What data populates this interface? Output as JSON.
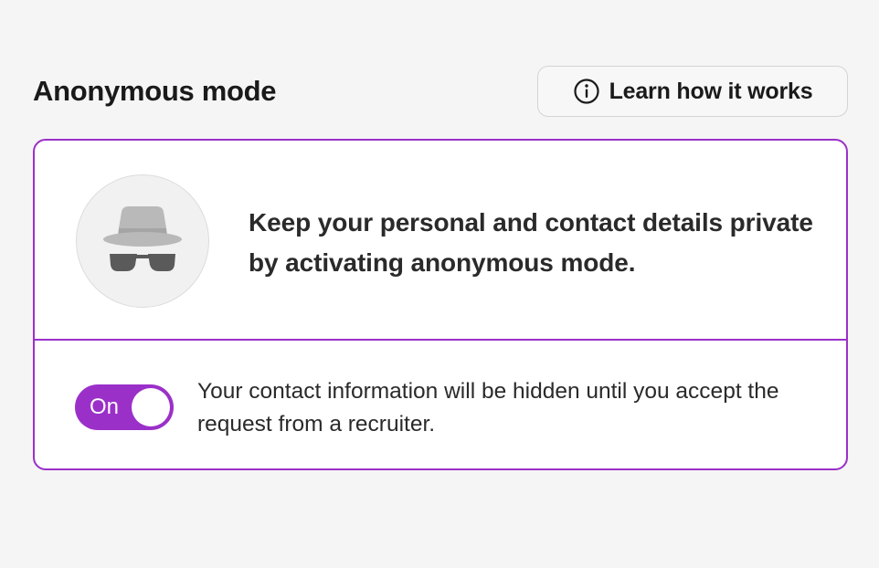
{
  "header": {
    "title": "Anonymous mode",
    "learn_button_label": "Learn how it works",
    "learn_button_icon": "info-icon"
  },
  "card": {
    "border_color": "#9b30c9",
    "avatar_icon": "incognito-icon",
    "intro_text": "Keep your personal and contact details private by activating anonymous mode.",
    "toggle": {
      "label": "On",
      "state": true,
      "accent": "#9b30c9"
    },
    "toggle_description": "Your contact information will be hidden until you accept the request from a recruiter."
  }
}
